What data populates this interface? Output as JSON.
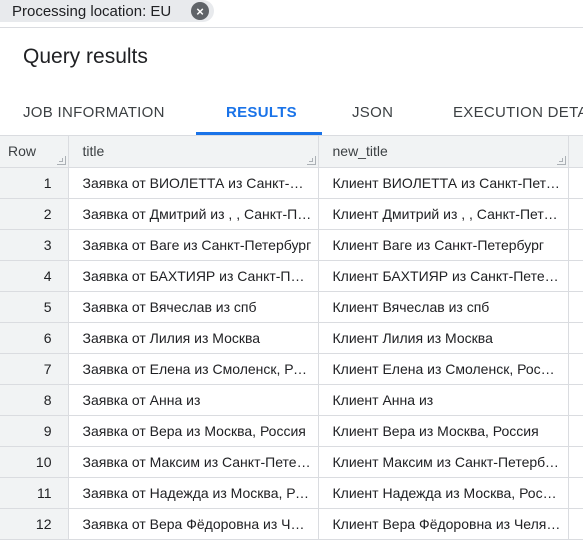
{
  "chip": {
    "label": "Processing location: EU",
    "close_icon": "close-circle-icon"
  },
  "page_title": "Query results",
  "tabs": [
    {
      "label": "JOB INFORMATION",
      "active": false
    },
    {
      "label": "RESULTS",
      "active": true
    },
    {
      "label": "JSON",
      "active": false
    },
    {
      "label": "EXECUTION DETA",
      "active": false
    }
  ],
  "table": {
    "headers": {
      "row": "Row",
      "title": "title",
      "new_title": "new_title"
    },
    "rows": [
      {
        "row": "1",
        "title": "Заявка от ВИОЛЕТТА из Санкт-Петербург",
        "new_title": "Клиент ВИОЛЕТТА из Санкт-Петербург"
      },
      {
        "row": "2",
        "title": "Заявка от Дмитрий из , , Санкт-Петербург",
        "new_title": "Клиент Дмитрий из , , Санкт-Петербург"
      },
      {
        "row": "3",
        "title": "Заявка от Ваге из Санкт-Петербург",
        "new_title": "Клиент Ваге из Санкт-Петербург"
      },
      {
        "row": "4",
        "title": "Заявка от БАХТИЯР из Санкт-Петербург",
        "new_title": "Клиент БАХТИЯР из Санкт-Петербург"
      },
      {
        "row": "5",
        "title": "Заявка от Вячеслав из спб",
        "new_title": "Клиент Вячеслав из спб"
      },
      {
        "row": "6",
        "title": "Заявка от Лилия из Москва",
        "new_title": "Клиент Лилия из Москва"
      },
      {
        "row": "7",
        "title": "Заявка от Елена из Смоленск, Россия",
        "new_title": "Клиент Елена из Смоленск, Россия"
      },
      {
        "row": "8",
        "title": "Заявка от Анна  из",
        "new_title": "Клиент Анна  из"
      },
      {
        "row": "9",
        "title": "Заявка от Вера из Москва, Россия",
        "new_title": "Клиент Вера из Москва, Россия"
      },
      {
        "row": "10",
        "title": "Заявка от Максим из Санкт-Петербург",
        "new_title": "Клиент Максим из Санкт-Петербург"
      },
      {
        "row": "11",
        "title": "Заявка от Надежда из Москва, Россия",
        "new_title": "Клиент Надежда из Москва, Россия"
      },
      {
        "row": "12",
        "title": "Заявка от Вера Фёдоровна из Челябинск",
        "new_title": "Клиент Вера Фёдоровна из Челябинск"
      }
    ]
  },
  "colors": {
    "accent": "#1a73e8",
    "header_bg": "#f1f3f4",
    "border": "#dadce0",
    "chip_bg": "#e8eaed"
  }
}
